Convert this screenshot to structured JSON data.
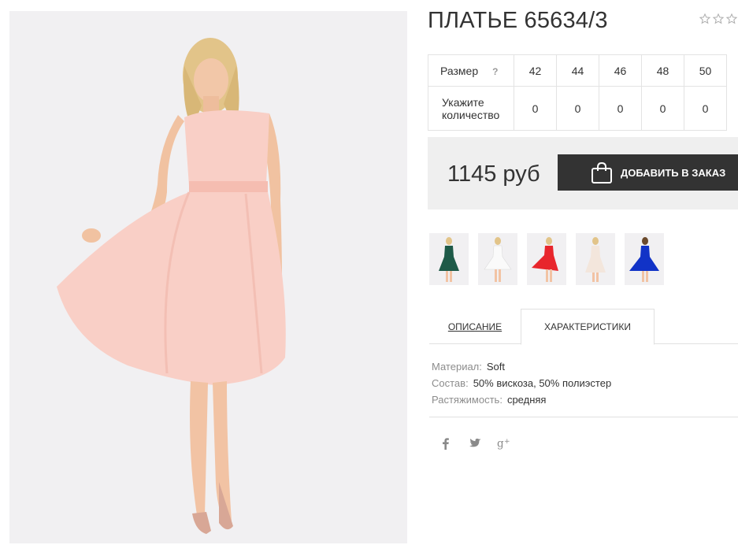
{
  "product": {
    "title": "ПЛАТЬЕ 65634/3",
    "rating_icon": "star-outline-icon",
    "rating_stars": 0,
    "rating_max": 3
  },
  "sizes": {
    "size_label": "Размер",
    "help_label": "?",
    "quantity_label_line1": "Укажите",
    "quantity_label_line2": "количество",
    "items": [
      {
        "size": "42",
        "qty": "0"
      },
      {
        "size": "44",
        "qty": "0"
      },
      {
        "size": "46",
        "qty": "0"
      },
      {
        "size": "48",
        "qty": "0"
      },
      {
        "size": "50",
        "qty": "0"
      }
    ]
  },
  "purchase": {
    "price": "1145 руб",
    "add_button_label": "ДОБАВИТЬ В ЗАКАЗ",
    "button_icon": "shopping-bag-icon"
  },
  "color_variants": [
    {
      "name": "green",
      "color": "#1e5a48"
    },
    {
      "name": "white",
      "color": "#f4f4f4"
    },
    {
      "name": "red",
      "color": "#e8262c"
    },
    {
      "name": "cream",
      "color": "#f3e6dc"
    },
    {
      "name": "blue",
      "color": "#1133c7"
    }
  ],
  "tabs": [
    {
      "label": "ОПИСАНИЕ",
      "active": false
    },
    {
      "label": "ХАРАКТЕРИСТИКИ",
      "active": true
    }
  ],
  "characteristics": [
    {
      "key": "Материал:",
      "value": "Soft"
    },
    {
      "key": "Состав:",
      "value": "50% вискоза, 50% полиэстер"
    },
    {
      "key": "Растяжимость:",
      "value": "средняя"
    }
  ],
  "social": [
    {
      "name": "facebook-icon"
    },
    {
      "name": "twitter-icon"
    },
    {
      "name": "google-plus-icon"
    }
  ],
  "colors": {
    "dress_main": "#f9cfc6",
    "button_bg": "#333333",
    "price_box_bg": "#efefef"
  }
}
